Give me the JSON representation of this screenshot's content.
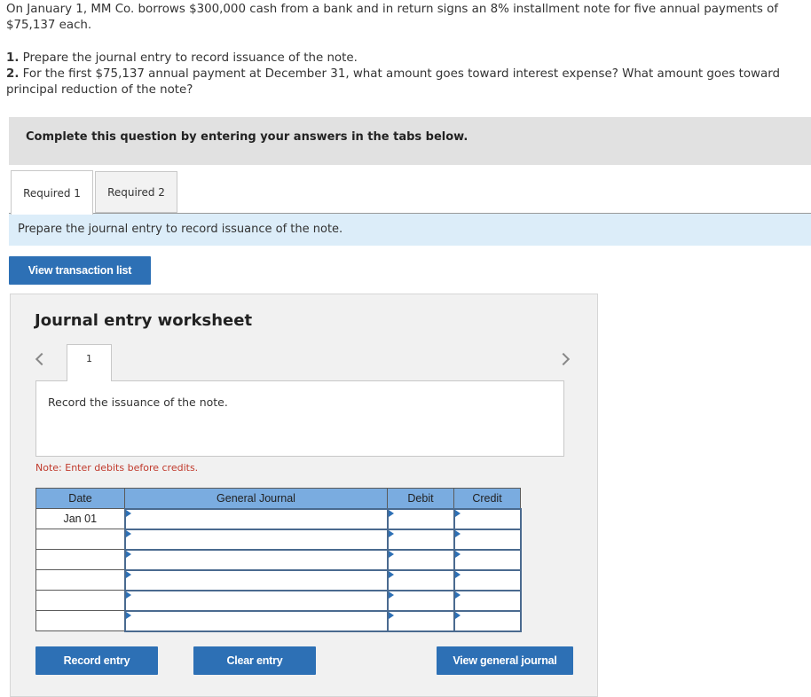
{
  "problem": {
    "intro": "On January 1, MM Co. borrows $300,000 cash from a bank and in return signs an 8% installment note for five annual payments of $75,137 each.",
    "questions": [
      {
        "number": "1.",
        "text": "Prepare the journal entry to record issuance of the note."
      },
      {
        "number": "2.",
        "text": "For the first $75,137 annual payment at December 31, what amount goes toward interest expense? What amount goes toward principal reduction of the note?"
      }
    ]
  },
  "banner": {
    "text": "Complete this question by entering your answers in the tabs below."
  },
  "tabs": [
    {
      "label": "Required 1",
      "active": true
    },
    {
      "label": "Required 2",
      "active": false
    }
  ],
  "instruction": "Prepare the journal entry to record issuance of the note.",
  "buttons": {
    "view_transaction_list": "View transaction list",
    "record_entry": "Record entry",
    "clear_entry": "Clear entry",
    "view_general_journal": "View general journal"
  },
  "worksheet": {
    "title": "Journal entry worksheet",
    "page_number": "1",
    "prev_icon": "chevron-left-icon",
    "next_icon": "chevron-right-icon",
    "description": "Record the issuance of the note.",
    "note": "Note: Enter debits before credits.",
    "table": {
      "headers": [
        "Date",
        "General Journal",
        "Debit",
        "Credit"
      ],
      "rows": [
        {
          "date": "Jan 01",
          "account": "",
          "debit": "",
          "credit": ""
        },
        {
          "date": "",
          "account": "",
          "debit": "",
          "credit": ""
        },
        {
          "date": "",
          "account": "",
          "debit": "",
          "credit": ""
        },
        {
          "date": "",
          "account": "",
          "debit": "",
          "credit": ""
        },
        {
          "date": "",
          "account": "",
          "debit": "",
          "credit": ""
        },
        {
          "date": "",
          "account": "",
          "debit": "",
          "credit": ""
        }
      ]
    }
  },
  "colors": {
    "primary_button": "#2d70b5",
    "table_header": "#7aace0",
    "instruction_bg": "#dcedf9",
    "note_text": "#c0392b"
  }
}
